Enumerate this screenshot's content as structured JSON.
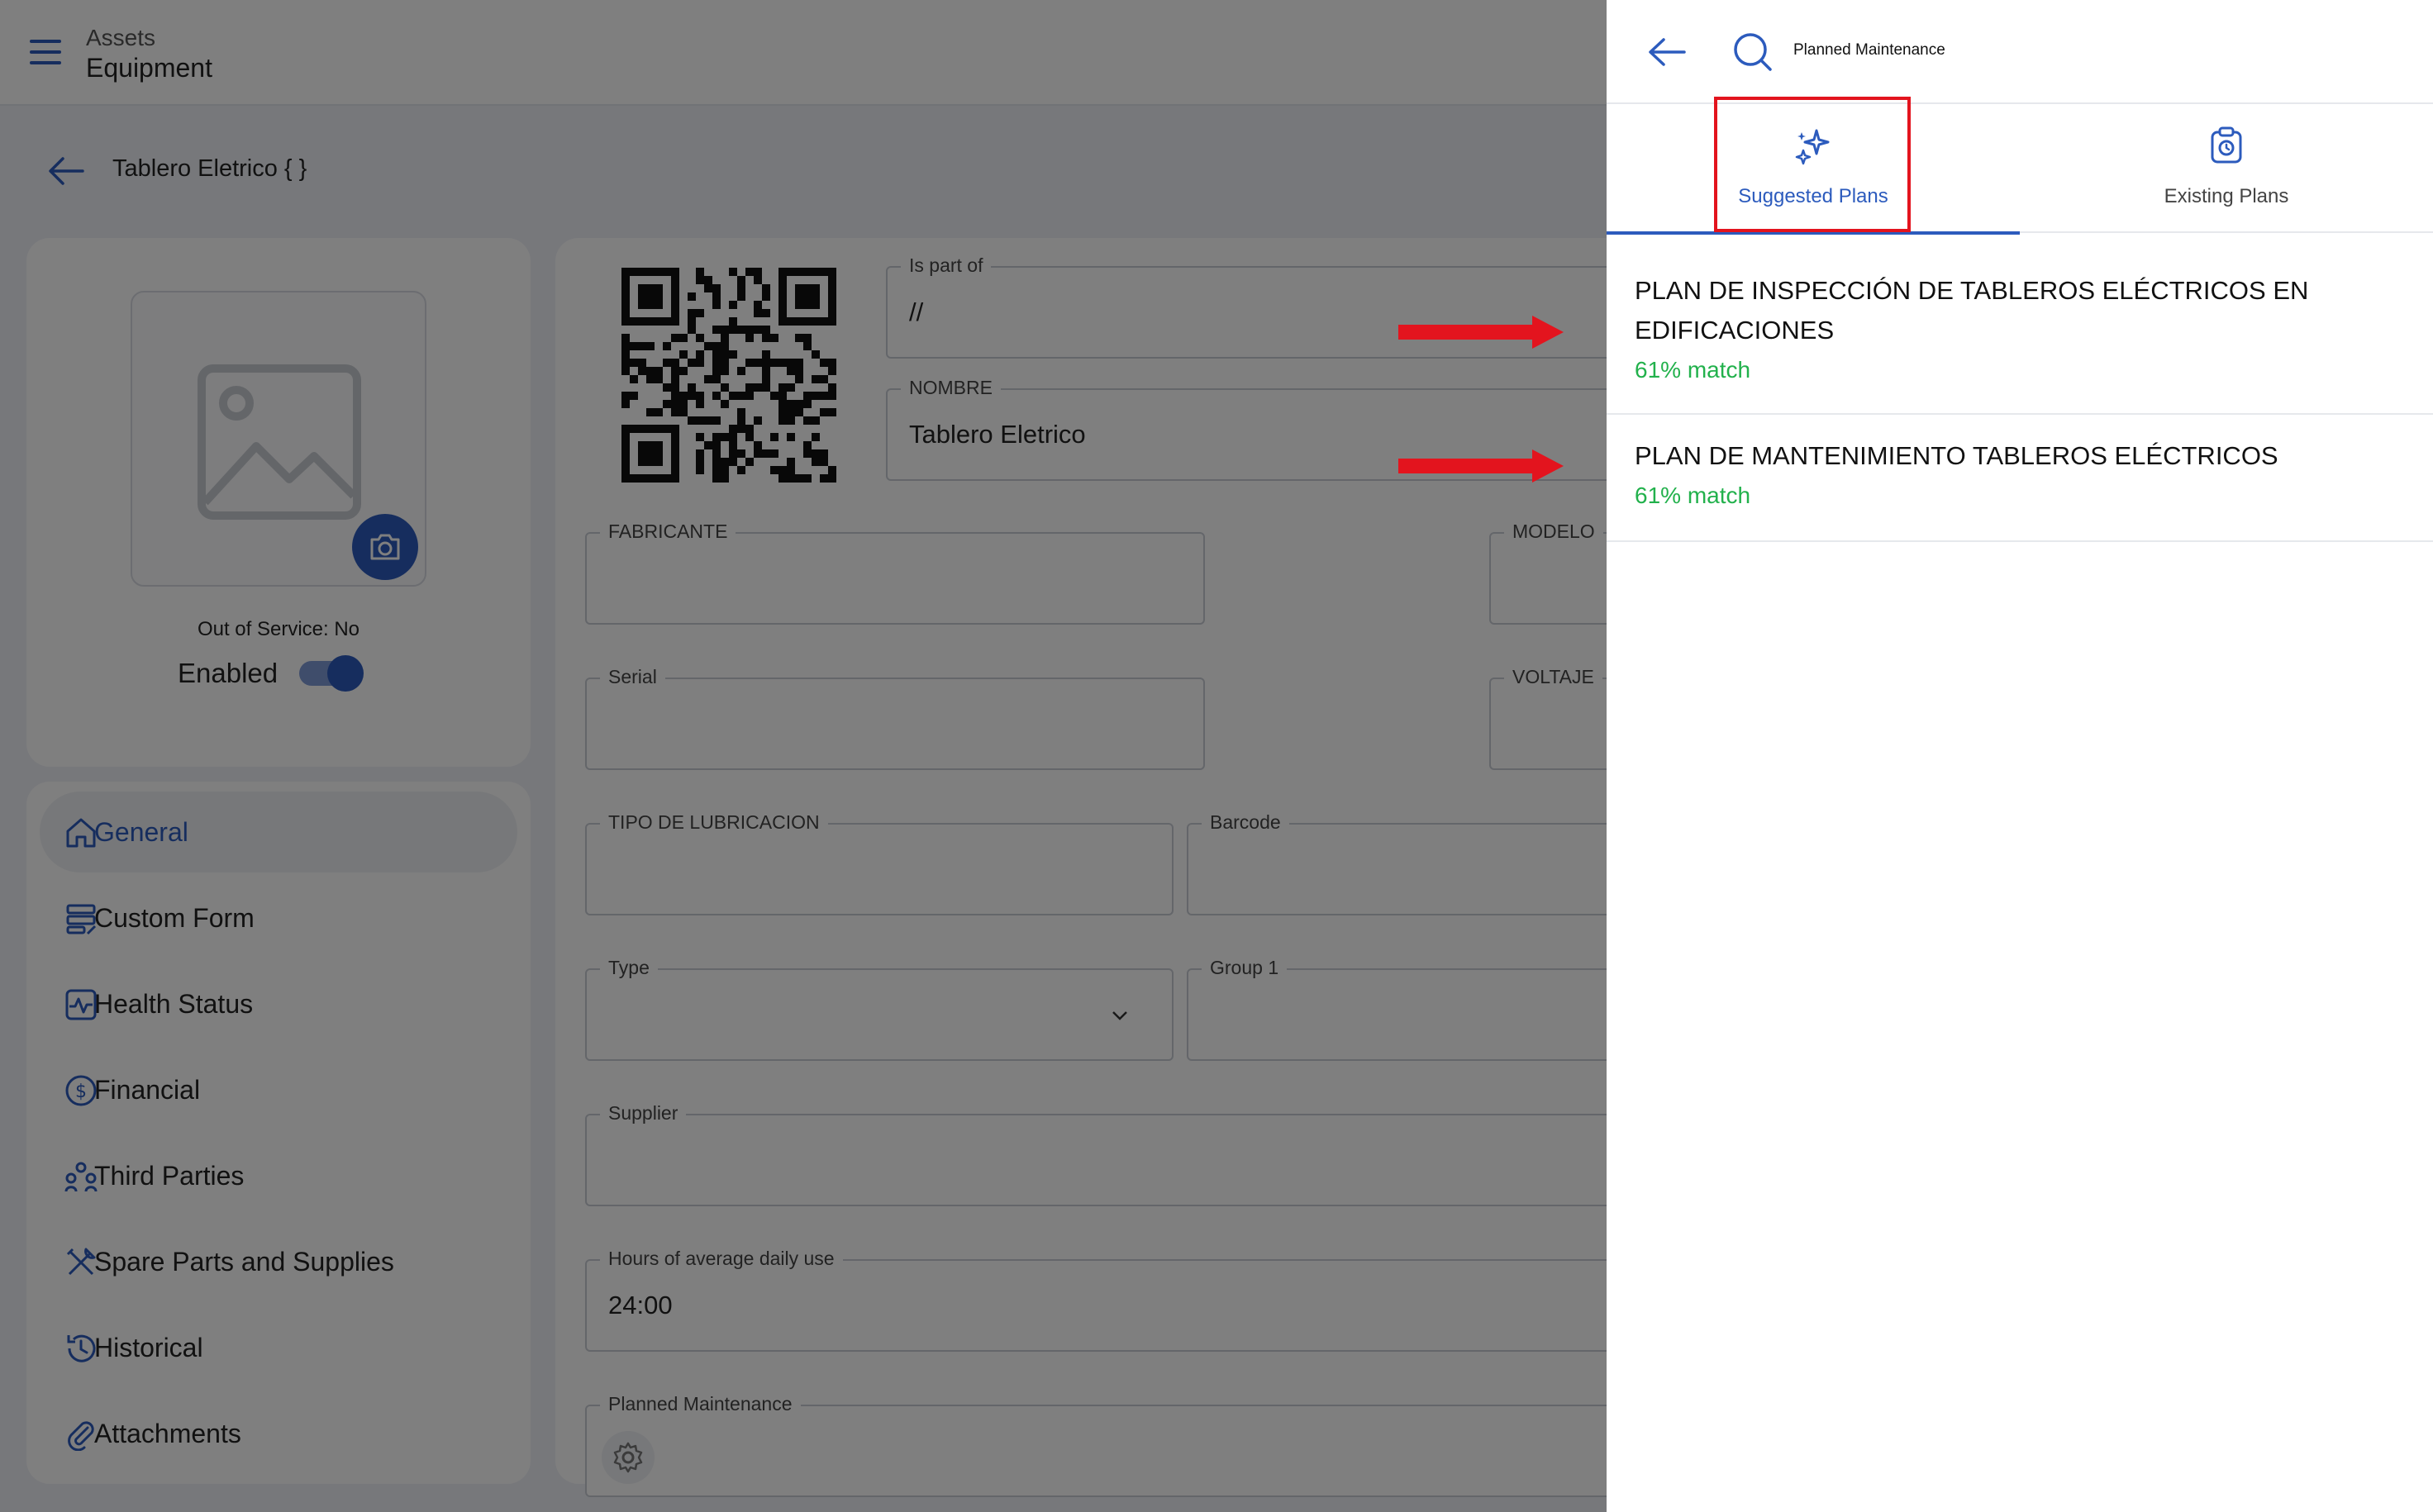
{
  "header": {
    "section": "Assets",
    "subsection": "Equipment"
  },
  "page": {
    "title": "Tablero Eletrico { }"
  },
  "asset_card": {
    "out_of_service": "Out of Service: No",
    "enabled_label": "Enabled",
    "enabled": true
  },
  "nav": {
    "items": [
      {
        "label": "General",
        "icon": "home-icon",
        "active": true
      },
      {
        "label": "Custom Form",
        "icon": "form-icon",
        "active": false
      },
      {
        "label": "Health Status",
        "icon": "pulse-icon",
        "active": false
      },
      {
        "label": "Financial",
        "icon": "dollar-icon",
        "active": false
      },
      {
        "label": "Third Parties",
        "icon": "people-icon",
        "active": false
      },
      {
        "label": "Spare Parts and Supplies",
        "icon": "tools-icon",
        "active": false
      },
      {
        "label": "Historical",
        "icon": "history-icon",
        "active": false
      },
      {
        "label": "Attachments",
        "icon": "paperclip-icon",
        "active": false
      }
    ]
  },
  "form": {
    "is_part_of": {
      "label": "Is part of",
      "value": "//"
    },
    "nombre": {
      "label": "NOMBRE",
      "value": "Tablero Eletrico"
    },
    "fabricante": {
      "label": "FABRICANTE",
      "value": ""
    },
    "modelo": {
      "label": "MODELO",
      "value": ""
    },
    "serial": {
      "label": "Serial",
      "value": ""
    },
    "voltaje": {
      "label": "VOLTAJE",
      "value": ""
    },
    "tipo_lubricacion": {
      "label": "TIPO DE LUBRICACION",
      "value": ""
    },
    "barcode": {
      "label": "Barcode",
      "value": ""
    },
    "type": {
      "label": "Type",
      "value": ""
    },
    "group1": {
      "label": "Group 1",
      "value": ""
    },
    "supplier": {
      "label": "Supplier",
      "value": ""
    },
    "hours": {
      "label": "Hours of average daily use",
      "value": "24:00"
    },
    "planned_maintenance": {
      "label": "Planned Maintenance",
      "value": ""
    }
  },
  "drawer": {
    "title": "Planned Maintenance",
    "tabs": [
      {
        "label": "Suggested Plans",
        "icon": "sparkles-icon",
        "active": true
      },
      {
        "label": "Existing Plans",
        "icon": "clipboard-icon",
        "active": false
      }
    ],
    "plans": [
      {
        "title": "PLAN DE INSPECCIÓN DE TABLEROS ELÉCTRICOS EN EDIFICACIONES",
        "match": "61% match"
      },
      {
        "title": "PLAN DE MANTENIMIENTO TABLEROS ELÉCTRICOS",
        "match": "61% match"
      }
    ]
  },
  "colors": {
    "accent": "#2c5bbd",
    "match_green": "#22b14c",
    "annotation_red": "#e3141e",
    "overlay": "rgba(0,0,0,0.5)"
  }
}
